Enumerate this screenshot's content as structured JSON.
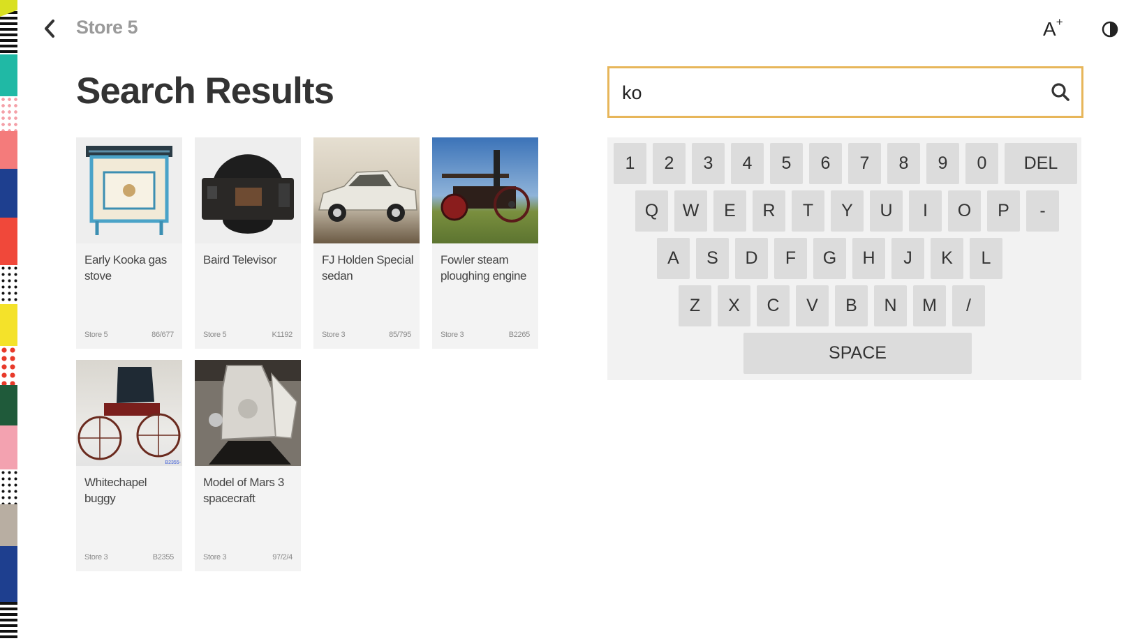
{
  "header": {
    "breadcrumb": "Store 5",
    "font_size_label": "A",
    "font_size_sup": "+"
  },
  "page_title": "Search Results",
  "search": {
    "value": "ko"
  },
  "results": [
    {
      "name": "Early Kooka gas stove",
      "store": "Store 5",
      "code": "86/677"
    },
    {
      "name": "Baird Televisor",
      "store": "Store 5",
      "code": "K1192"
    },
    {
      "name": "FJ Holden Special sedan",
      "store": "Store 3",
      "code": "85/795"
    },
    {
      "name": "Fowler steam ploughing engine",
      "store": "Store 3",
      "code": "B2265"
    },
    {
      "name": "Whitechapel buggy",
      "store": "Store 3",
      "code": "B2355"
    },
    {
      "name": "Model of Mars 3 spacecraft",
      "store": "Store 3",
      "code": "97/2/4"
    }
  ],
  "image_labels": {
    "buggy_tag": "B2355-"
  },
  "keyboard": {
    "row1": [
      "1",
      "2",
      "3",
      "4",
      "5",
      "6",
      "7",
      "8",
      "9",
      "0",
      "DEL"
    ],
    "row2": [
      "Q",
      "W",
      "E",
      "R",
      "T",
      "Y",
      "U",
      "I",
      "O",
      "P",
      "-"
    ],
    "row3": [
      "A",
      "S",
      "D",
      "F",
      "G",
      "H",
      "J",
      "K",
      "L"
    ],
    "row4": [
      "Z",
      "X",
      "C",
      "V",
      "B",
      "N",
      "M",
      "/"
    ],
    "space": "SPACE"
  },
  "colors": {
    "search_border": "#e7b65a",
    "card_bg": "#f3f3f3",
    "key_bg": "#dcdcdc",
    "keyboard_bg": "#f2f2f2",
    "breadcrumb": "#9a9a9a"
  },
  "icons": {
    "back": "chevron-left-icon",
    "font_size": "font-size-icon",
    "contrast": "contrast-icon",
    "search": "search-icon"
  }
}
